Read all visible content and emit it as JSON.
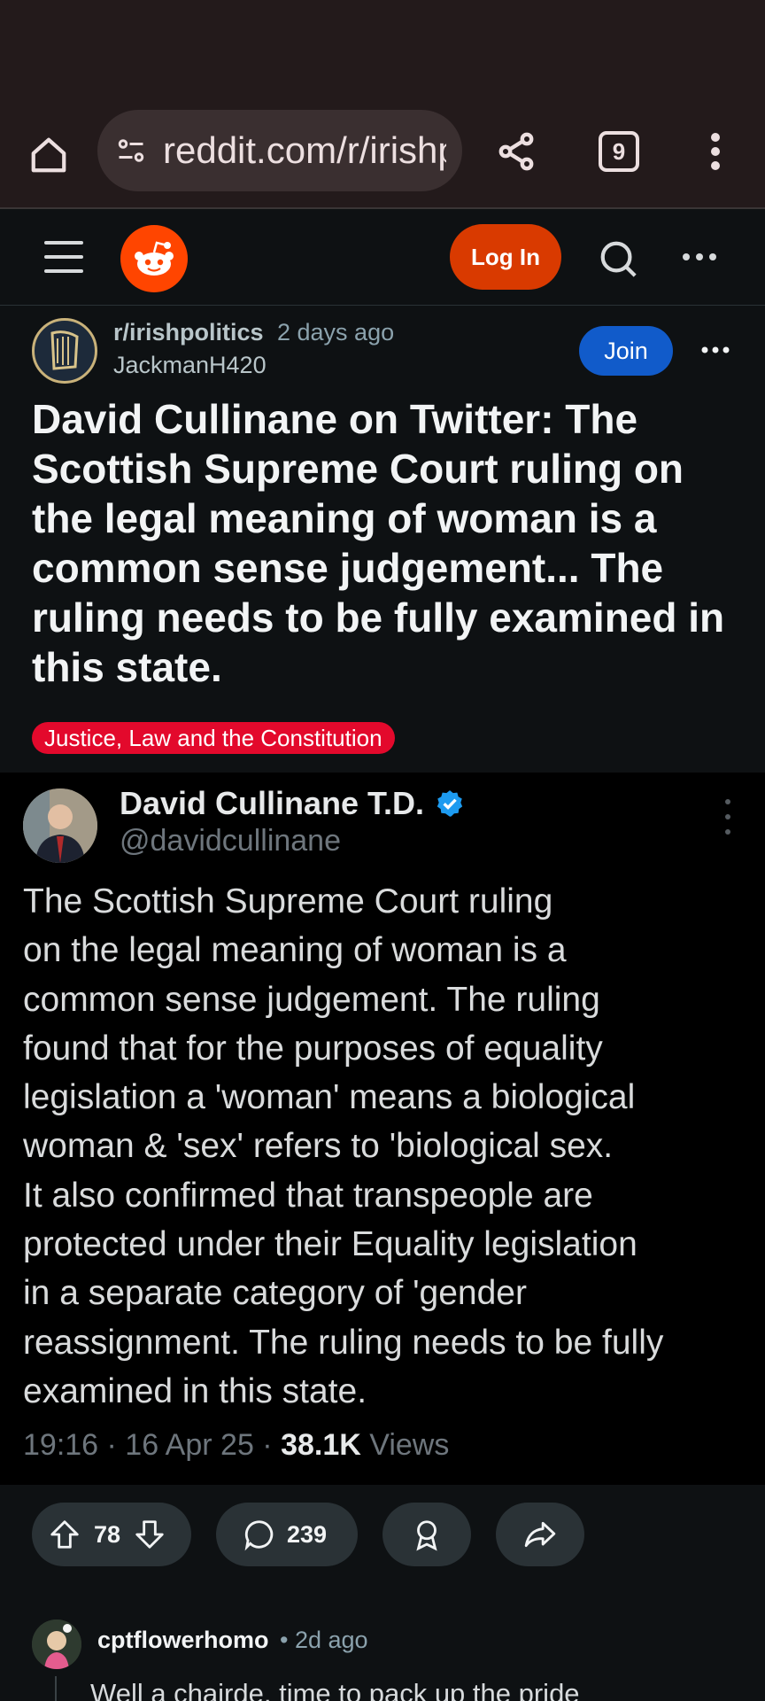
{
  "browser": {
    "url": "reddit.com/r/irishpolitics",
    "tab_count": "9"
  },
  "header": {
    "login_label": "Log In"
  },
  "post": {
    "subreddit": "r/irishpolitics",
    "time": "2 days ago",
    "author": "JackmanH420",
    "join_label": "Join",
    "title": "David Cullinane on Twitter: The Scottish Supreme Court ruling on the legal meaning of woman is a common sense judgement... The ruling needs to be fully examined in this state.",
    "flair": "Justice, Law and the Constitution"
  },
  "tweet": {
    "name": "David Cullinane T.D.",
    "handle": "@davidcullinane",
    "text": "The Scottish Supreme Court ruling\non the legal meaning of woman is a\ncommon sense judgement. The ruling\nfound that for the purposes of equality\nlegislation a 'woman' means a biological\nwoman &  'sex' refers to 'biological sex.\nIt also confirmed that transpeople are\nprotected under their Equality legislation\nin a separate category of 'gender\nreassignment. The ruling needs to be fully\nexamined in this state.",
    "time": "19:16 · 16 Apr 25 · ",
    "views_count": "38.1K",
    "views_label": " Views"
  },
  "actions": {
    "votes": "78",
    "comments": "239"
  },
  "comment": {
    "user": "cptflowerhomo",
    "time": "• 2d ago",
    "text": "Well a chairde, time to pack up the pride"
  },
  "colors": {
    "login": "#d93a00",
    "join": "#115bca",
    "flair": "#e3092c",
    "reddit_orange": "#ff4500"
  }
}
